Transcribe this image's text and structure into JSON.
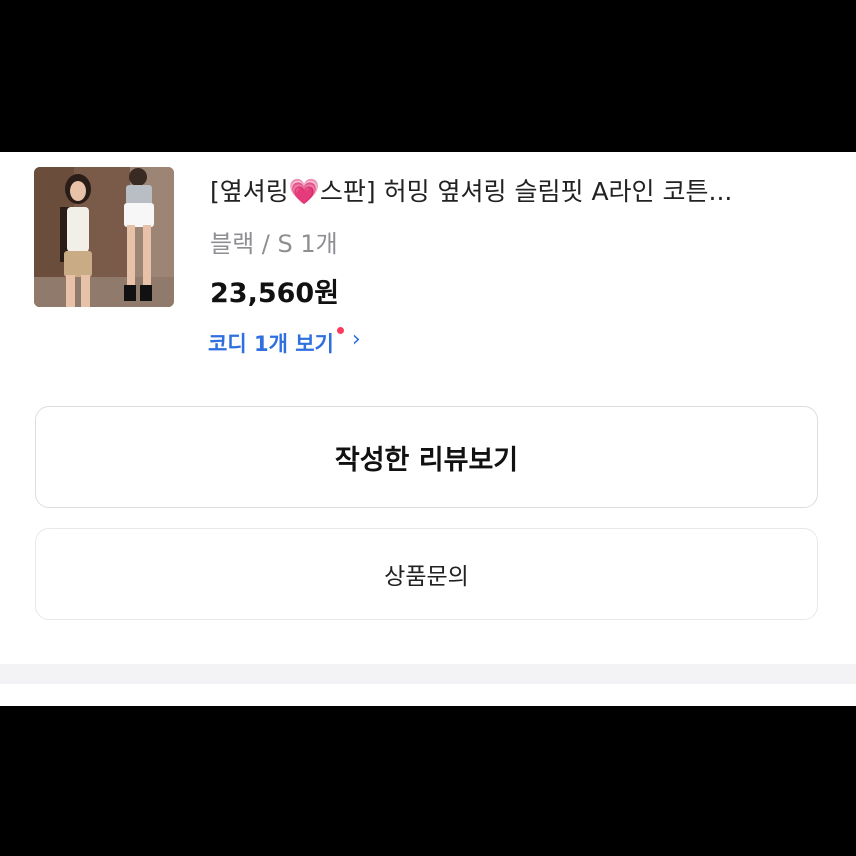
{
  "product": {
    "title_prefix": "[옆셔링",
    "title_heart": "💗",
    "title_suffix": "스판] 허밍 옆셔링 슬림핏 A라인 코튼...",
    "option": "블랙 / S 1개",
    "price": "23,560원"
  },
  "coordi": {
    "label": "코디 1개 보기",
    "dot_color": "#ff3b5c",
    "chevron": "›"
  },
  "buttons": {
    "review": "작성한 리뷰보기",
    "inquiry": "상품문의"
  },
  "colors": {
    "link_blue": "#2f6fe0",
    "heart_pink": "#e94d9b"
  }
}
